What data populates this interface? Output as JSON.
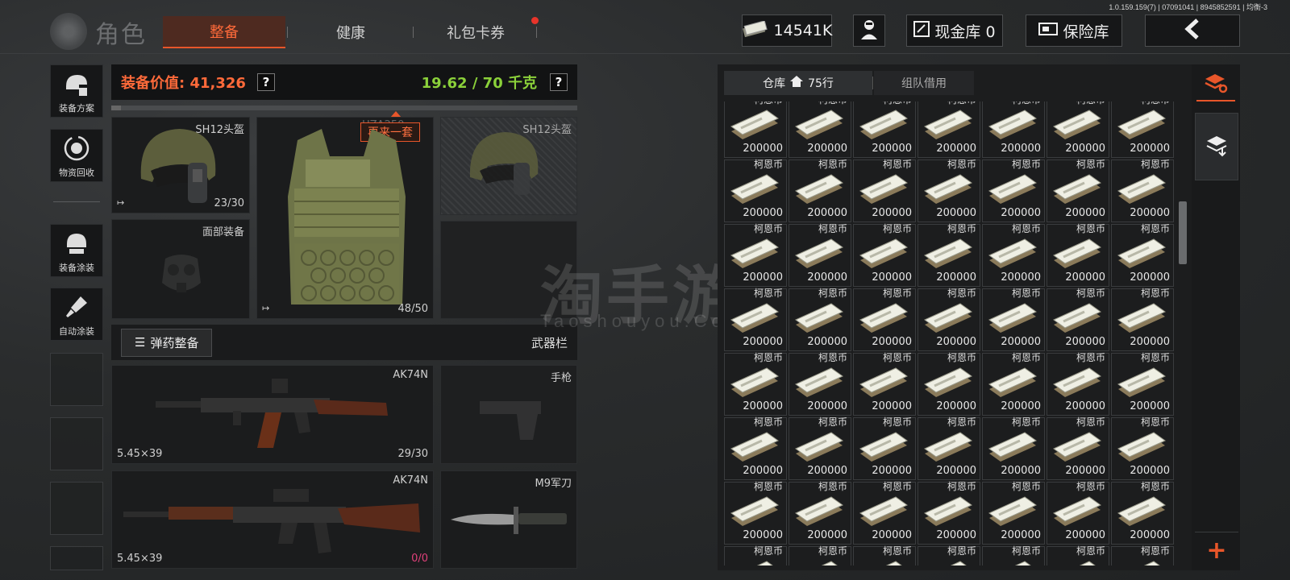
{
  "version": "1.0.159.159(7) | 07091041 | 8945852591 | 均衡-3",
  "header": {
    "title": "角色",
    "tabs": [
      "整备",
      "健康",
      "礼包卡券"
    ],
    "currency": "14541K",
    "cash_vault": "现金库 0",
    "insurance": "保险库"
  },
  "sidebar": [
    "装备方案",
    "物资回收",
    "装备涂装",
    "自动涂装"
  ],
  "equip": {
    "value_label": "装备价值: 41,326",
    "weight": "19.62 / 70 千克",
    "helmet_label": "SH12头盔",
    "helmet_count": "23/30",
    "helmet2_label": "SH12头盔",
    "face_label": "面部装备",
    "vest_tag": "再来一套",
    "vest_ghost": "HZA250",
    "vest_count": "48/50",
    "ammo_btn": "弹药整备",
    "weapon_bar": "武器栏",
    "weapon1": {
      "name": "AK74N",
      "caliber": "5.45×39",
      "count": "29/30"
    },
    "pistol": "手枪",
    "weapon2": {
      "name": "AK74N",
      "caliber": "5.45×39",
      "count": "0/0"
    },
    "knife": "M9军刀"
  },
  "warehouse": {
    "tab1": "仓库",
    "rows": "75行",
    "tab2": "组队借用",
    "item_name": "柯恩币",
    "item_amount": "200000"
  },
  "colors": {
    "accent": "#e8562a",
    "weight": "#8bd13a"
  }
}
